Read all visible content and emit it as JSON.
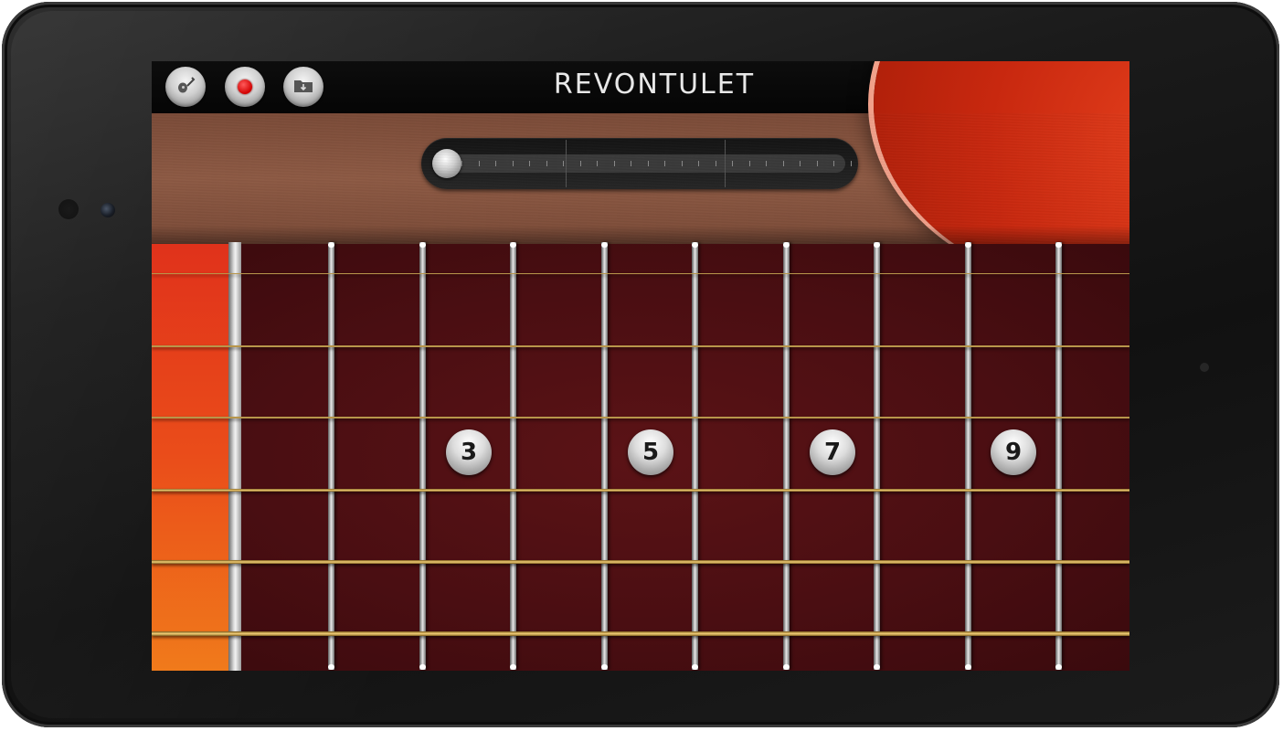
{
  "app": {
    "title": "REVONTULET"
  },
  "toolbar_left": [
    {
      "name": "guitar-instrument-button",
      "icon": "guitar-icon"
    },
    {
      "name": "record-button",
      "icon": "record-icon"
    },
    {
      "name": "open-folder-button",
      "icon": "folder-icon"
    }
  ],
  "toolbar_right": [
    {
      "name": "chord-book-button",
      "icon": "chord-book-icon"
    },
    {
      "name": "menu-button",
      "icon": "list-menu-icon"
    }
  ],
  "position_slider": {
    "value": 0,
    "sections": 3
  },
  "fretboard": {
    "fret_markers": [
      "3",
      "5",
      "7",
      "9"
    ],
    "string_count": 6,
    "fret_count": 9
  },
  "colors": {
    "body_wood": "#8d5a44",
    "red_accent": "#d9310f",
    "fretboard": "#4a0e12",
    "string_gold": "#e8c46a",
    "record_red": "#d10000"
  }
}
